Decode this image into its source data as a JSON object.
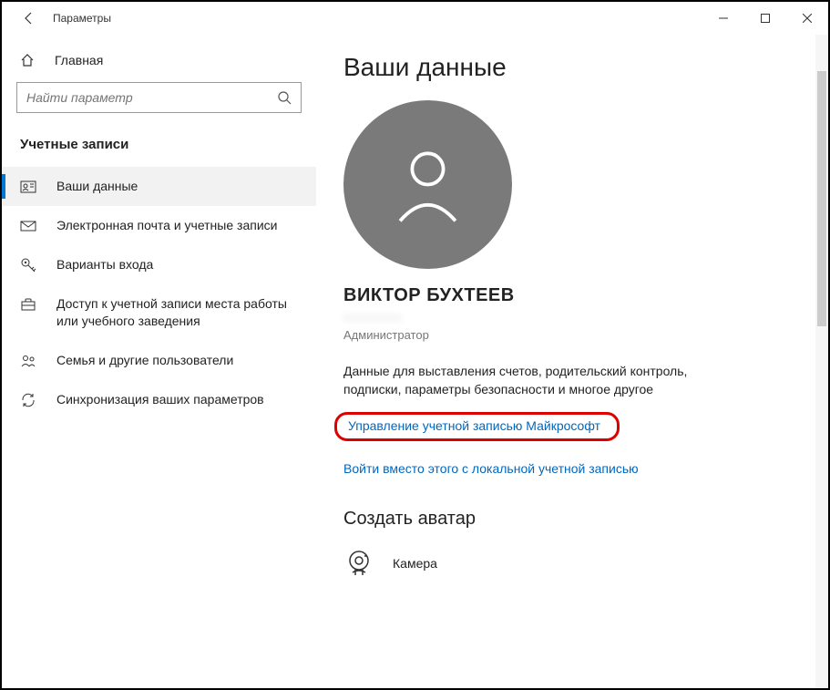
{
  "window": {
    "title": "Параметры"
  },
  "sidebar": {
    "home_label": "Главная",
    "search_placeholder": "Найти параметр",
    "section_header": "Учетные записи",
    "items": [
      {
        "label": "Ваши данные",
        "icon": "user-card-icon",
        "active": true
      },
      {
        "label": "Электронная почта и учетные записи",
        "icon": "mail-icon",
        "active": false
      },
      {
        "label": "Варианты входа",
        "icon": "key-icon",
        "active": false
      },
      {
        "label": "Доступ к учетной записи места работы или учебного заведения",
        "icon": "briefcase-icon",
        "active": false
      },
      {
        "label": "Семья и другие пользователи",
        "icon": "people-icon",
        "active": false
      },
      {
        "label": "Синхронизация ваших параметров",
        "icon": "sync-icon",
        "active": false
      }
    ]
  },
  "main": {
    "page_title": "Ваши данные",
    "user_name": "ВИКТОР БУХТЕЕВ",
    "user_email": "•••••••••••••",
    "user_role": "Администратор",
    "info_text": "Данные для выставления счетов, родительский контроль, подписки, параметры безопасности и многое другое",
    "manage_link": "Управление учетной записью Майкрософт",
    "local_login_link": "Войти вместо этого с локальной учетной записью",
    "create_avatar_title": "Создать аватар",
    "camera_label": "Камера"
  }
}
